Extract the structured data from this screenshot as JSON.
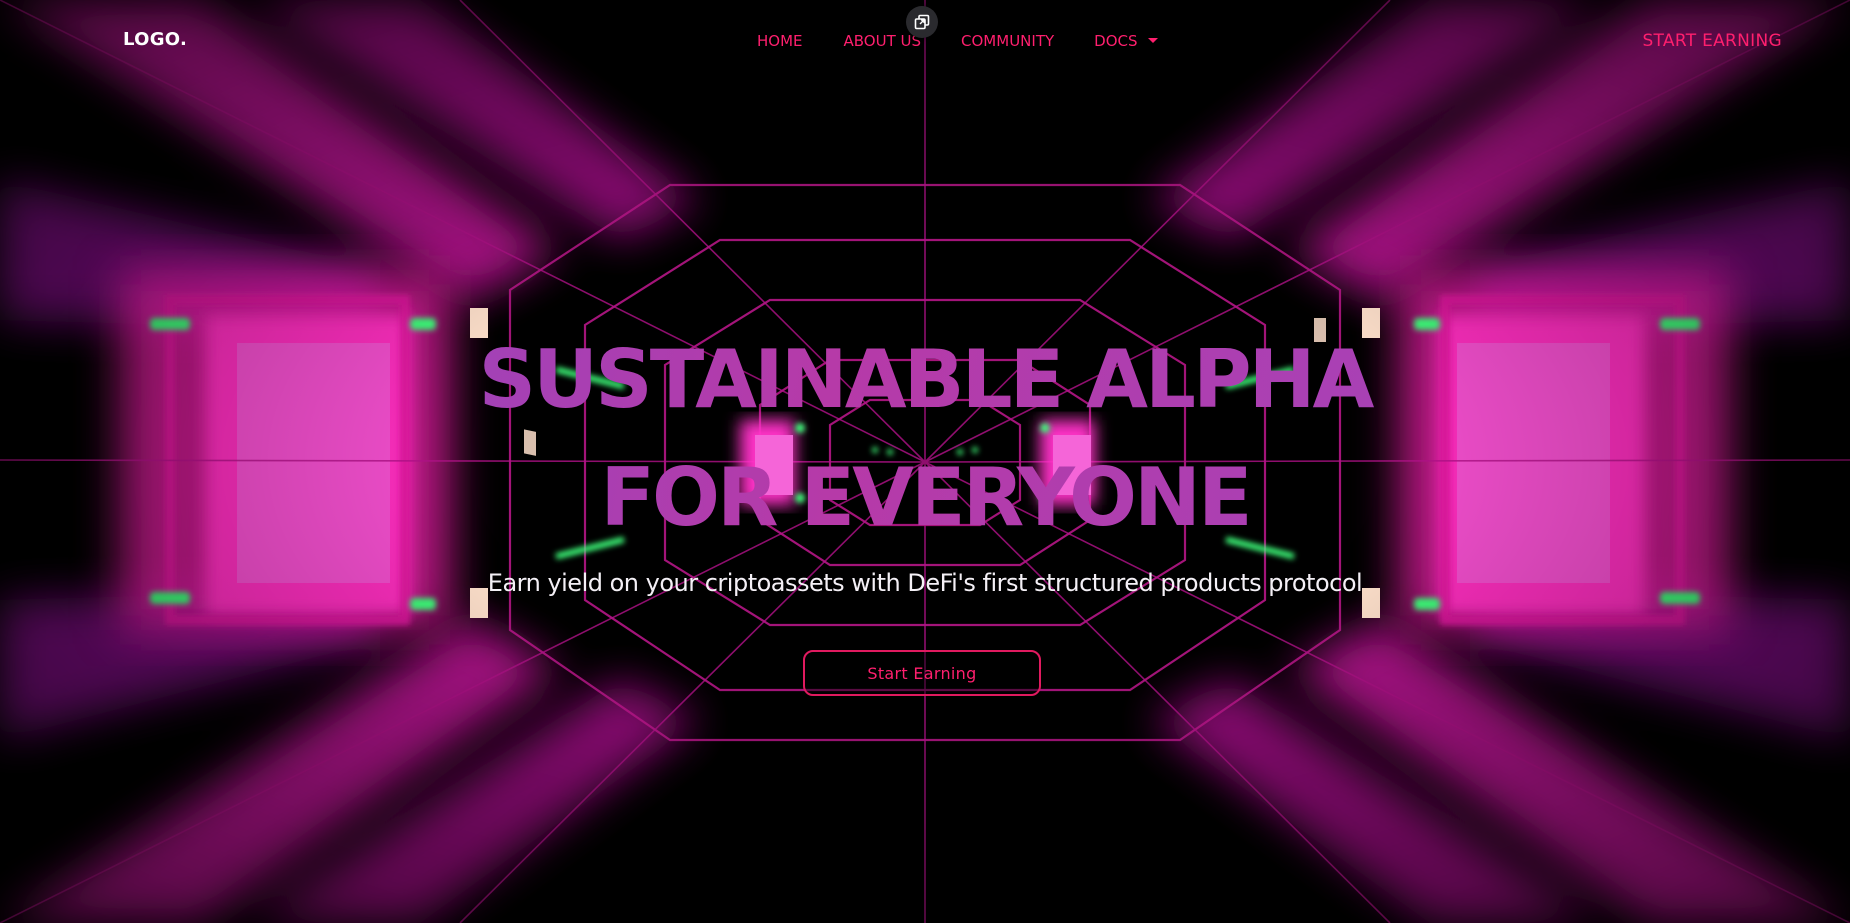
{
  "nav": {
    "logo": "LOGO.",
    "links": [
      {
        "label": "HOME"
      },
      {
        "label": "ABOUT US"
      },
      {
        "label": "COMMUNITY"
      },
      {
        "label": "DOCS"
      }
    ],
    "cta": "START EARNING"
  },
  "hero": {
    "title_line1": "SUSTAINABLE ALPHA",
    "title_line2": "FOR EVERYONE",
    "subtitle": "Earn yield on your criptoassets with DeFi's first structured products protocol",
    "button_label": "Start Earning"
  },
  "colors": {
    "accent": "#ff1f6e",
    "title_gradient_start": "#8a4bc9",
    "title_gradient_mid": "#b63aa8",
    "background": "#000000",
    "neon_pink": "#ff2fc0",
    "neon_green": "#3dff7a"
  },
  "icons": {
    "floating_action": "external-window-icon",
    "docs_dropdown": "caret-down-icon"
  }
}
